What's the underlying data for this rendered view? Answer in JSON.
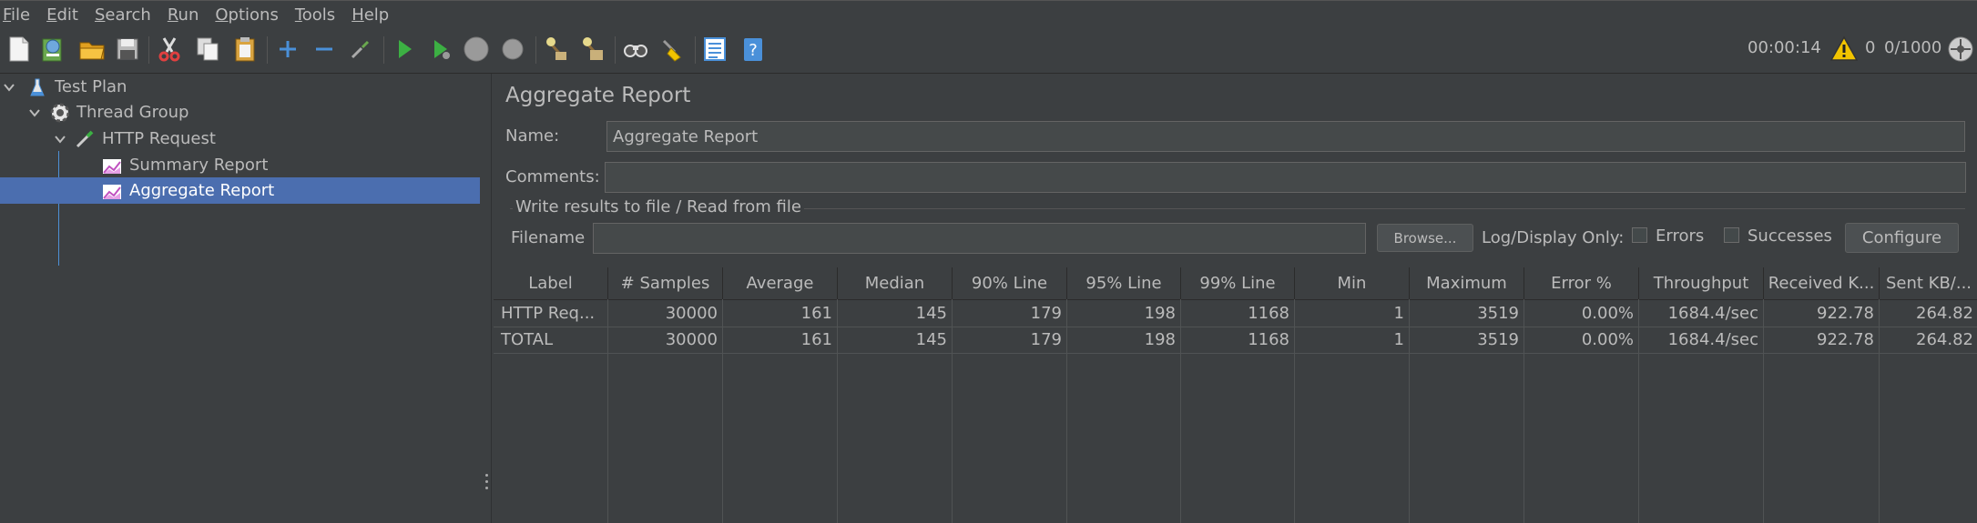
{
  "menu": [
    "File",
    "Edit",
    "Search",
    "Run",
    "Options",
    "Tools",
    "Help"
  ],
  "menu_mnemonics": [
    "F",
    "E",
    "S",
    "R",
    "O",
    "T",
    "H"
  ],
  "toolbar": {
    "icons": [
      "new-icon",
      "templates-icon",
      "open-icon",
      "save-icon",
      "cut-icon",
      "copy-icon",
      "paste-icon",
      "expand-icon",
      "collapse-icon",
      "toggle-icon",
      "start-icon",
      "start-no-pauses-icon",
      "stop-icon",
      "shutdown-icon",
      "clear-icon",
      "clear-all-icon",
      "search-icon",
      "reset-search-icon",
      "function-helper-icon",
      "help-icon"
    ],
    "elapsed": "00:00:14",
    "warnings": "0",
    "threads": "0/1000"
  },
  "tree": [
    {
      "label": "Test Plan",
      "icon": "flask-icon"
    },
    {
      "label": "Thread Group",
      "icon": "gear-icon"
    },
    {
      "label": "HTTP Request",
      "icon": "pipette-icon"
    },
    {
      "label": "Summary Report",
      "icon": "graph-icon"
    },
    {
      "label": "Aggregate Report",
      "icon": "graph-icon",
      "selected": true
    }
  ],
  "panel": {
    "title": "Aggregate Report",
    "name_label": "Name:",
    "name_value": "Aggregate Report",
    "comments_label": "Comments:",
    "comments_value": "",
    "fieldset_legend": "Write results to file / Read from file",
    "filename_label": "Filename",
    "filename_value": "",
    "browse_label": "Browse...",
    "log_display_label": "Log/Display Only:",
    "errors_label": "Errors",
    "successes_label": "Successes",
    "configure_label": "Configure"
  },
  "table": {
    "columns": [
      "Label",
      "# Samples",
      "Average",
      "Median",
      "90% Line",
      "95% Line",
      "99% Line",
      "Min",
      "Maximum",
      "Error %",
      "Throughput",
      "Received K...",
      "Sent KB/..."
    ],
    "rows": [
      [
        "HTTP Req...",
        "30000",
        "161",
        "145",
        "179",
        "198",
        "1168",
        "1",
        "3519",
        "0.00%",
        "1684.4/sec",
        "922.78",
        "264.82"
      ],
      [
        "TOTAL",
        "30000",
        "161",
        "145",
        "179",
        "198",
        "1168",
        "1",
        "3519",
        "0.00%",
        "1684.4/sec",
        "922.78",
        "264.82"
      ]
    ]
  }
}
